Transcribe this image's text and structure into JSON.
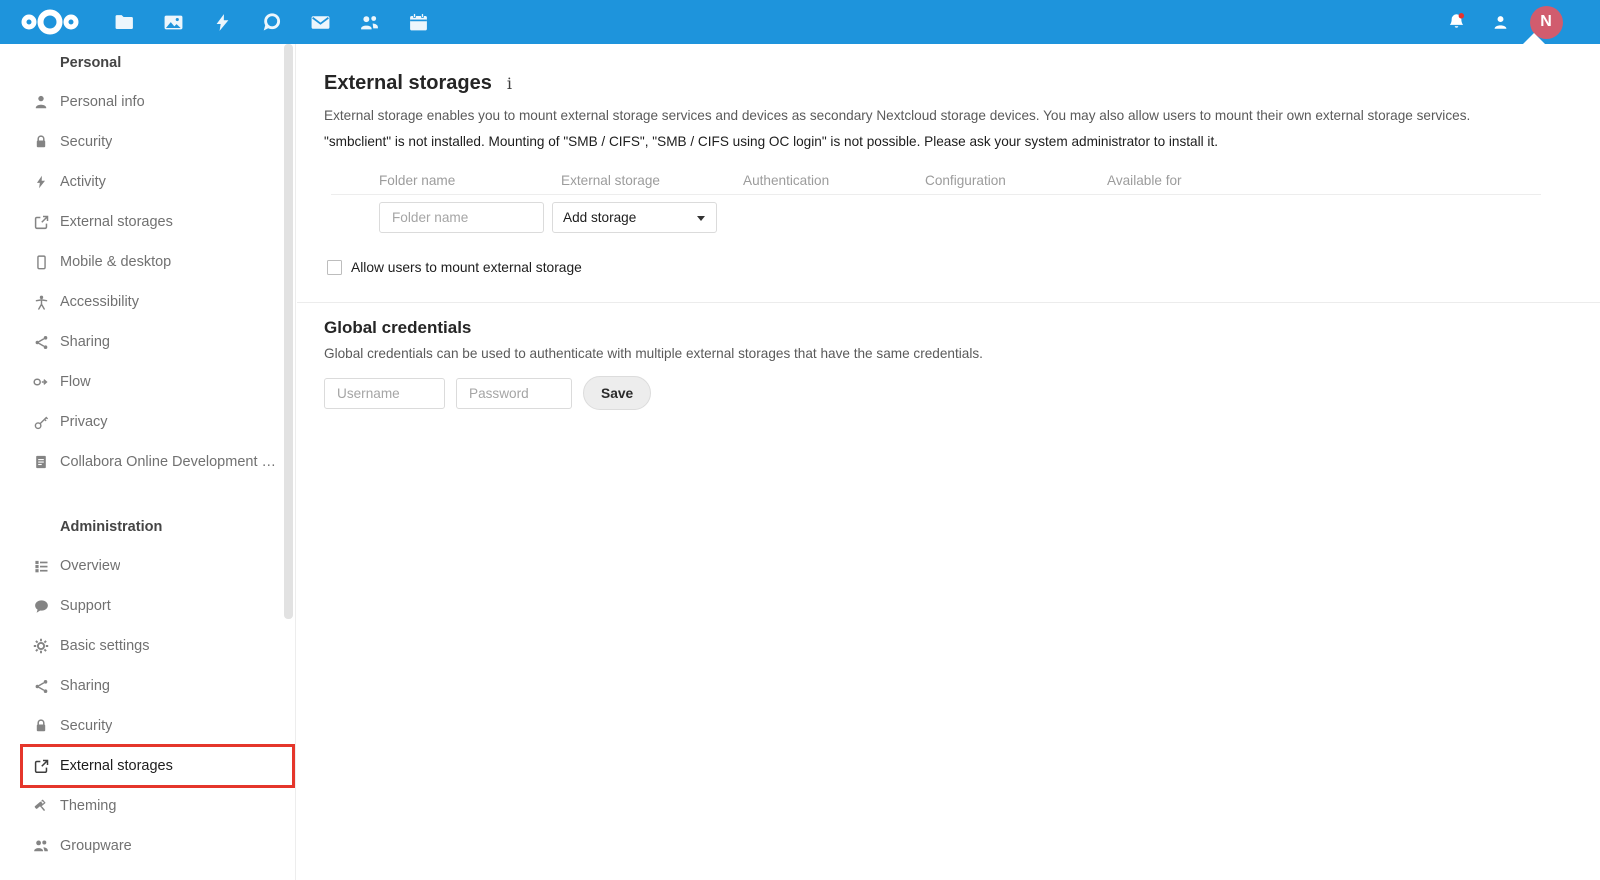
{
  "topbar": {
    "app_icons": [
      "nextcloud-logo",
      "files-folder-icon",
      "photos-icon",
      "activity-icon",
      "talk-icon",
      "mail-icon",
      "contacts-icon",
      "calendar-icon"
    ],
    "right_icons": [
      "notifications-bell-icon",
      "contacts-menu-icon",
      "avatar"
    ],
    "avatar_initial": "N",
    "colors": {
      "bar": "#1e94dc",
      "avatar": "#d15c6e",
      "notification_dot": "#e9322d"
    }
  },
  "sidebar": {
    "highlight_color": "#e5362b",
    "sections": [
      {
        "header": "Personal",
        "items": [
          {
            "label": "Personal info",
            "icon": "user-icon"
          },
          {
            "label": "Security",
            "icon": "lock-icon"
          },
          {
            "label": "Activity",
            "icon": "lightning-icon"
          },
          {
            "label": "External storages",
            "icon": "external-link-icon"
          },
          {
            "label": "Mobile & desktop",
            "icon": "phone-icon"
          },
          {
            "label": "Accessibility",
            "icon": "accessibility-icon"
          },
          {
            "label": "Sharing",
            "icon": "share-icon"
          },
          {
            "label": "Flow",
            "icon": "flow-icon"
          },
          {
            "label": "Privacy",
            "icon": "key-icon"
          },
          {
            "label": "Collabora Online Development Edit...",
            "icon": "document-icon"
          }
        ]
      },
      {
        "header": "Administration",
        "items": [
          {
            "label": "Overview",
            "icon": "list-icon"
          },
          {
            "label": "Support",
            "icon": "speech-bubble-icon"
          },
          {
            "label": "Basic settings",
            "icon": "gear-icon"
          },
          {
            "label": "Sharing",
            "icon": "share-icon"
          },
          {
            "label": "Security",
            "icon": "lock-icon"
          },
          {
            "label": "External storages",
            "icon": "external-link-icon",
            "highlighted": true
          },
          {
            "label": "Theming",
            "icon": "paint-roller-icon"
          },
          {
            "label": "Groupware",
            "icon": "group-icon"
          }
        ]
      }
    ]
  },
  "main": {
    "title": "External storages",
    "info_icon": "i",
    "description": "External storage enables you to mount external storage services and devices as secondary Nextcloud storage devices. You may also allow users to mount their own external storage services.",
    "warning": "\"smbclient\" is not installed. Mounting of \"SMB / CIFS\", \"SMB / CIFS using OC login\" is not possible. Please ask your system administrator to install it.",
    "table": {
      "headers": [
        "Folder name",
        "External storage",
        "Authentication",
        "Configuration",
        "Available for"
      ]
    },
    "new_row": {
      "folder_placeholder": "Folder name",
      "storage_select": "Add storage"
    },
    "allow_checkbox_label": "Allow users to mount external storage",
    "global_credentials": {
      "title": "Global credentials",
      "description": "Global credentials can be used to authenticate with multiple external storages that have the same credentials.",
      "username_placeholder": "Username",
      "password_placeholder": "Password",
      "save_label": "Save"
    }
  }
}
